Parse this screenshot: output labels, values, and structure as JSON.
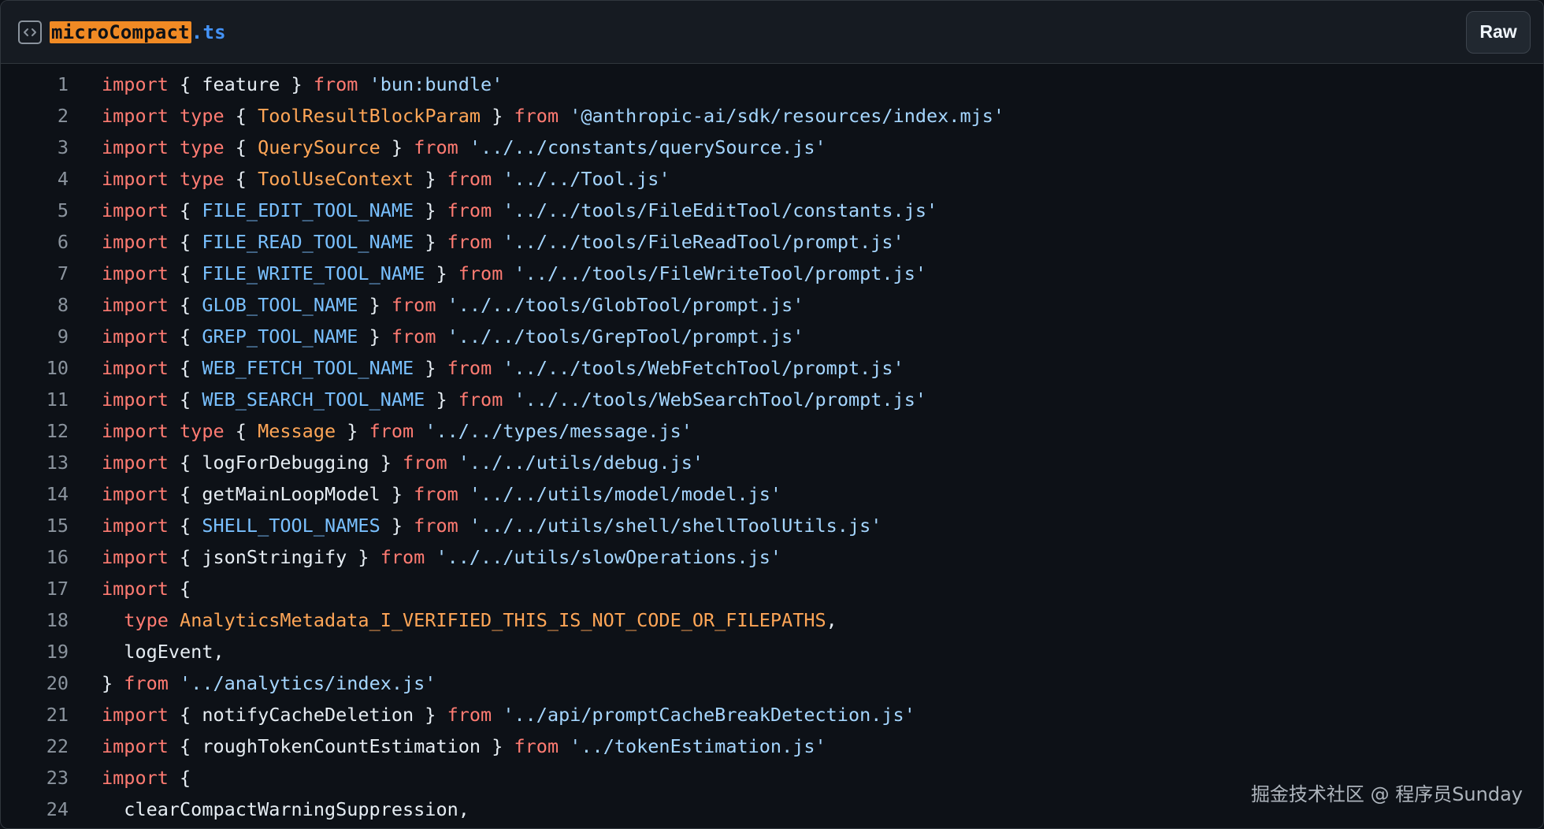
{
  "header": {
    "file_icon": "code-file-icon",
    "file_name_highlight": "microCompact",
    "file_name_ext": ".ts",
    "raw_label": "Raw"
  },
  "code_lines": [
    {
      "n": "1",
      "tokens": [
        [
          "k",
          "import"
        ],
        [
          "p",
          " { feature } "
        ],
        [
          "k",
          "from"
        ],
        [
          "p",
          " "
        ],
        [
          "s",
          "'bun:bundle'"
        ]
      ]
    },
    {
      "n": "2",
      "tokens": [
        [
          "k",
          "import type"
        ],
        [
          "p",
          " { "
        ],
        [
          "t",
          "ToolResultBlockParam"
        ],
        [
          "p",
          " } "
        ],
        [
          "k",
          "from"
        ],
        [
          "p",
          " "
        ],
        [
          "s",
          "'@anthropic-ai/sdk/resources/index.mjs'"
        ]
      ]
    },
    {
      "n": "3",
      "tokens": [
        [
          "k",
          "import type"
        ],
        [
          "p",
          " { "
        ],
        [
          "t",
          "QuerySource"
        ],
        [
          "p",
          " } "
        ],
        [
          "k",
          "from"
        ],
        [
          "p",
          " "
        ],
        [
          "s",
          "'../../constants/querySource.js'"
        ]
      ]
    },
    {
      "n": "4",
      "tokens": [
        [
          "k",
          "import type"
        ],
        [
          "p",
          " { "
        ],
        [
          "t",
          "ToolUseContext"
        ],
        [
          "p",
          " } "
        ],
        [
          "k",
          "from"
        ],
        [
          "p",
          " "
        ],
        [
          "s",
          "'../../Tool.js'"
        ]
      ]
    },
    {
      "n": "5",
      "tokens": [
        [
          "k",
          "import"
        ],
        [
          "p",
          " { "
        ],
        [
          "c",
          "FILE_EDIT_TOOL_NAME"
        ],
        [
          "p",
          " } "
        ],
        [
          "k",
          "from"
        ],
        [
          "p",
          " "
        ],
        [
          "s",
          "'../../tools/FileEditTool/constants.js'"
        ]
      ]
    },
    {
      "n": "6",
      "tokens": [
        [
          "k",
          "import"
        ],
        [
          "p",
          " { "
        ],
        [
          "c",
          "FILE_READ_TOOL_NAME"
        ],
        [
          "p",
          " } "
        ],
        [
          "k",
          "from"
        ],
        [
          "p",
          " "
        ],
        [
          "s",
          "'../../tools/FileReadTool/prompt.js'"
        ]
      ]
    },
    {
      "n": "7",
      "tokens": [
        [
          "k",
          "import"
        ],
        [
          "p",
          " { "
        ],
        [
          "c",
          "FILE_WRITE_TOOL_NAME"
        ],
        [
          "p",
          " } "
        ],
        [
          "k",
          "from"
        ],
        [
          "p",
          " "
        ],
        [
          "s",
          "'../../tools/FileWriteTool/prompt.js'"
        ]
      ]
    },
    {
      "n": "8",
      "tokens": [
        [
          "k",
          "import"
        ],
        [
          "p",
          " { "
        ],
        [
          "c",
          "GLOB_TOOL_NAME"
        ],
        [
          "p",
          " } "
        ],
        [
          "k",
          "from"
        ],
        [
          "p",
          " "
        ],
        [
          "s",
          "'../../tools/GlobTool/prompt.js'"
        ]
      ]
    },
    {
      "n": "9",
      "tokens": [
        [
          "k",
          "import"
        ],
        [
          "p",
          " { "
        ],
        [
          "c",
          "GREP_TOOL_NAME"
        ],
        [
          "p",
          " } "
        ],
        [
          "k",
          "from"
        ],
        [
          "p",
          " "
        ],
        [
          "s",
          "'../../tools/GrepTool/prompt.js'"
        ]
      ]
    },
    {
      "n": "10",
      "tokens": [
        [
          "k",
          "import"
        ],
        [
          "p",
          " { "
        ],
        [
          "c",
          "WEB_FETCH_TOOL_NAME"
        ],
        [
          "p",
          " } "
        ],
        [
          "k",
          "from"
        ],
        [
          "p",
          " "
        ],
        [
          "s",
          "'../../tools/WebFetchTool/prompt.js'"
        ]
      ]
    },
    {
      "n": "11",
      "tokens": [
        [
          "k",
          "import"
        ],
        [
          "p",
          " { "
        ],
        [
          "c",
          "WEB_SEARCH_TOOL_NAME"
        ],
        [
          "p",
          " } "
        ],
        [
          "k",
          "from"
        ],
        [
          "p",
          " "
        ],
        [
          "s",
          "'../../tools/WebSearchTool/prompt.js'"
        ]
      ]
    },
    {
      "n": "12",
      "tokens": [
        [
          "k",
          "import type"
        ],
        [
          "p",
          " { "
        ],
        [
          "t",
          "Message"
        ],
        [
          "p",
          " } "
        ],
        [
          "k",
          "from"
        ],
        [
          "p",
          " "
        ],
        [
          "s",
          "'../../types/message.js'"
        ]
      ]
    },
    {
      "n": "13",
      "tokens": [
        [
          "k",
          "import"
        ],
        [
          "p",
          " { logForDebugging } "
        ],
        [
          "k",
          "from"
        ],
        [
          "p",
          " "
        ],
        [
          "s",
          "'../../utils/debug.js'"
        ]
      ]
    },
    {
      "n": "14",
      "tokens": [
        [
          "k",
          "import"
        ],
        [
          "p",
          " { getMainLoopModel } "
        ],
        [
          "k",
          "from"
        ],
        [
          "p",
          " "
        ],
        [
          "s",
          "'../../utils/model/model.js'"
        ]
      ]
    },
    {
      "n": "15",
      "tokens": [
        [
          "k",
          "import"
        ],
        [
          "p",
          " { "
        ],
        [
          "c",
          "SHELL_TOOL_NAMES"
        ],
        [
          "p",
          " } "
        ],
        [
          "k",
          "from"
        ],
        [
          "p",
          " "
        ],
        [
          "s",
          "'../../utils/shell/shellToolUtils.js'"
        ]
      ]
    },
    {
      "n": "16",
      "tokens": [
        [
          "k",
          "import"
        ],
        [
          "p",
          " { jsonStringify } "
        ],
        [
          "k",
          "from"
        ],
        [
          "p",
          " "
        ],
        [
          "s",
          "'../../utils/slowOperations.js'"
        ]
      ]
    },
    {
      "n": "17",
      "tokens": [
        [
          "k",
          "import"
        ],
        [
          "p",
          " {"
        ]
      ]
    },
    {
      "n": "18",
      "tokens": [
        [
          "p",
          "  "
        ],
        [
          "k",
          "type"
        ],
        [
          "p",
          " "
        ],
        [
          "t",
          "AnalyticsMetadata_I_VERIFIED_THIS_IS_NOT_CODE_OR_FILEPATHS"
        ],
        [
          "p",
          ","
        ]
      ]
    },
    {
      "n": "19",
      "tokens": [
        [
          "p",
          "  logEvent,"
        ]
      ]
    },
    {
      "n": "20",
      "tokens": [
        [
          "p",
          "} "
        ],
        [
          "k",
          "from"
        ],
        [
          "p",
          " "
        ],
        [
          "s",
          "'../analytics/index.js'"
        ]
      ]
    },
    {
      "n": "21",
      "tokens": [
        [
          "k",
          "import"
        ],
        [
          "p",
          " { notifyCacheDeletion } "
        ],
        [
          "k",
          "from"
        ],
        [
          "p",
          " "
        ],
        [
          "s",
          "'../api/promptCacheBreakDetection.js'"
        ]
      ]
    },
    {
      "n": "22",
      "tokens": [
        [
          "k",
          "import"
        ],
        [
          "p",
          " { roughTokenCountEstimation } "
        ],
        [
          "k",
          "from"
        ],
        [
          "p",
          " "
        ],
        [
          "s",
          "'../tokenEstimation.js'"
        ]
      ]
    },
    {
      "n": "23",
      "tokens": [
        [
          "k",
          "import"
        ],
        [
          "p",
          " {"
        ]
      ]
    },
    {
      "n": "24",
      "tokens": [
        [
          "p",
          "  clearCompactWarningSuppression,"
        ]
      ]
    }
  ],
  "watermark": "掘金技术社区 @ 程序员Sunday",
  "colors": {
    "background": "#0d1117",
    "header_bg": "#161b22",
    "keyword": "#ff7b72",
    "string": "#a5d6ff",
    "type": "#ffa657",
    "constant": "#79c0ff",
    "plain": "#e6edf3",
    "line_number": "#8b949e",
    "filename": "#4493f8",
    "highlight": "#f08a24"
  }
}
